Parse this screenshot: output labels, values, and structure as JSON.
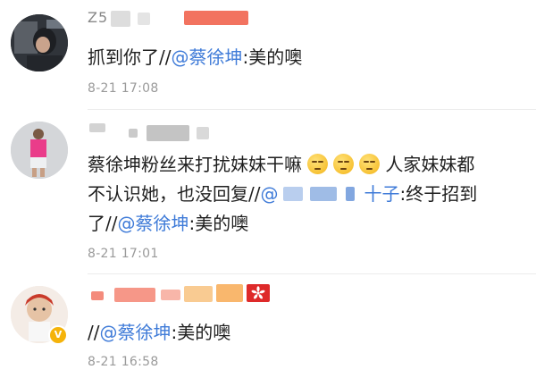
{
  "comments": [
    {
      "username_visible": "Z5",
      "segments": [
        {
          "text": "抓到你了//"
        },
        {
          "text": "@蔡徐坤",
          "mention": true
        },
        {
          "text": ":美的噢"
        }
      ],
      "time": "8-21 17:08"
    },
    {
      "line1": [
        {
          "text": "蔡徐坤粉丝来打扰妹妹干嘛"
        }
      ],
      "emojis": [
        "sleepy-face-emoji",
        "sleepy-face-emoji",
        "sleepy-face-emoji"
      ],
      "line1_after": "人家妹妹都",
      "line2_before": "不认识她，也没回复//",
      "line2_partial": "@",
      "line2_partial_end": "十子",
      "line2_tail": ":终于招到",
      "line3_before": "了//",
      "line3_mention": "@蔡徐坤",
      "line3_tail": ":美的噢",
      "time": "8-21 17:01"
    },
    {
      "segments": [
        {
          "text": "//"
        },
        {
          "text": "@蔡徐坤",
          "mention": true
        },
        {
          "text": ":美的噢"
        }
      ],
      "time": "8-21 16:58",
      "verified_badge": "V"
    }
  ],
  "colors": {
    "mention": "#3f7bd8",
    "time": "#9a9a9a",
    "blur_red": "#f05a44",
    "blur_grey": "#b9b9b9"
  }
}
